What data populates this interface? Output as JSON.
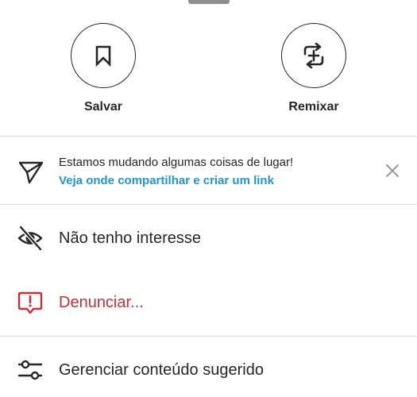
{
  "actions": {
    "save_label": "Salvar",
    "remix_label": "Remixar"
  },
  "notice": {
    "title": "Estamos mudando algumas coisas de lugar!",
    "link": "Veja onde compartilhar e criar um link"
  },
  "menu": [
    {
      "label": "Não tenho interesse",
      "icon": "eye-slash-icon"
    },
    {
      "label": "Denunciar...",
      "icon": "report-icon"
    },
    {
      "label": "Gerenciar conteúdo sugerido",
      "icon": "sliders-icon"
    }
  ],
  "colors": {
    "text": "#262626",
    "link": "#1f96d3",
    "danger": "#c3303b",
    "divider": "#dbdbdb"
  }
}
